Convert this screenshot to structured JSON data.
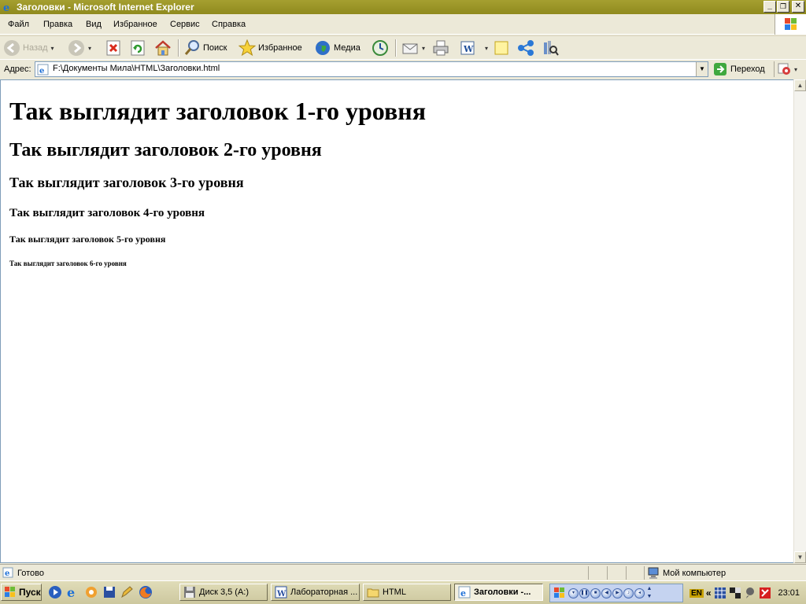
{
  "window": {
    "title": "Заголовки - Microsoft Internet Explorer",
    "minimize_label": "_",
    "maximize_label": "❐",
    "close_label": "✕"
  },
  "menu": {
    "items": [
      {
        "label": "Файл"
      },
      {
        "label": "Правка"
      },
      {
        "label": "Вид"
      },
      {
        "label": "Избранное"
      },
      {
        "label": "Сервис"
      },
      {
        "label": "Справка"
      }
    ]
  },
  "toolbar": {
    "back_label": "Назад",
    "search_label": "Поиск",
    "favorites_label": "Избранное",
    "media_label": "Медиа"
  },
  "address": {
    "label": "Адрес:",
    "value": "F:\\Документы Мила\\HTML\\Заголовки.html",
    "go_label": "Переход"
  },
  "page": {
    "h1": "Так выглядит заголовок 1-го уровня",
    "h2": "Так выглядит заголовок 2-го уровня",
    "h3": "Так выглядит заголовок 3-го уровня",
    "h4": "Так выглядит заголовок 4-го уровня",
    "h5": "Так выглядит заголовок 5-го уровня",
    "h6": "Так выглядит заголовок 6-го уровня"
  },
  "status": {
    "text": "Готово",
    "zone": "Мой компьютер"
  },
  "taskbar": {
    "start_label": "Пуск",
    "tasks": [
      {
        "label": "Диск 3,5 (A:)",
        "icon": "floppy-icon"
      },
      {
        "label": "Лабораторная ...",
        "icon": "word-icon"
      },
      {
        "label": "HTML",
        "icon": "folder-icon"
      },
      {
        "label": "Заголовки -...",
        "icon": "ie-icon",
        "active": true
      }
    ],
    "language": "EN",
    "tray_expand": "«",
    "clock": "23:01"
  },
  "colors": {
    "titlebar": "#a59f30",
    "chrome": "#ece9d8",
    "content_bg": "#ffffff"
  }
}
